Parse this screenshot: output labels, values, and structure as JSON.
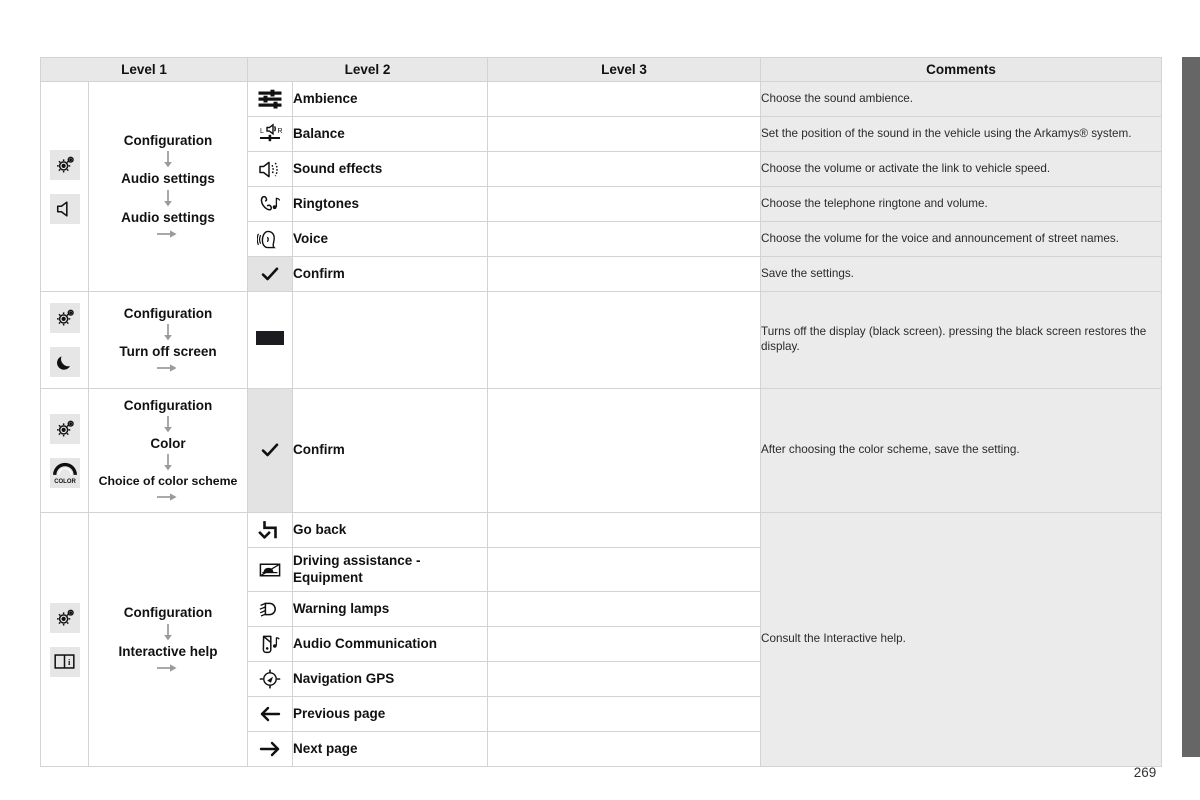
{
  "page": {
    "number": "269"
  },
  "table": {
    "headers": [
      "Level 1",
      "Level 2",
      "Level 3",
      "Comments"
    ],
    "blocks": [
      {
        "id": "audio-settings",
        "level1": {
          "icons": [
            "gear-icon",
            "speaker-icon"
          ],
          "steps": [
            "Configuration",
            "Audio settings",
            "Audio settings"
          ],
          "trailing_arrow": true
        },
        "rows": [
          {
            "icon": "equalizer-icon",
            "icon_shaded": false,
            "label": "Ambience",
            "level3": "",
            "comment": "Choose the sound ambience."
          },
          {
            "icon": "balance-icon",
            "icon_shaded": false,
            "label": "Balance",
            "level3": "",
            "comment": "Set the position of the sound in the vehicle using the Arkamys® system."
          },
          {
            "icon": "sound-effects-icon",
            "icon_shaded": false,
            "label": "Sound effects",
            "level3": "",
            "comment": "Choose the volume or activate the link to vehicle speed."
          },
          {
            "icon": "ringtone-icon",
            "icon_shaded": false,
            "label": "Ringtones",
            "level3": "",
            "comment": "Choose the telephone ringtone and volume."
          },
          {
            "icon": "voice-icon",
            "icon_shaded": false,
            "label": "Voice",
            "level3": "",
            "comment": "Choose the volume for the voice and announcement of street names."
          },
          {
            "icon": "check-icon",
            "icon_shaded": true,
            "label": "Confirm",
            "level3": "",
            "comment": "Save the settings."
          }
        ]
      },
      {
        "id": "turn-off-screen",
        "level1": {
          "icons": [
            "gear-icon",
            "moon-icon"
          ],
          "steps": [
            "Configuration",
            "Turn off screen"
          ],
          "trailing_arrow": true
        },
        "rows": [
          {
            "icon": "black-screen-icon",
            "icon_shaded": false,
            "label": "",
            "level3": "",
            "comment": "Turns off the display (black screen). pressing the black screen restores the display."
          }
        ]
      },
      {
        "id": "color",
        "level1": {
          "icons": [
            "gear-icon",
            "color-icon"
          ],
          "steps": [
            "Configuration",
            "Color",
            "Choice of color scheme"
          ],
          "trailing_arrow": true
        },
        "rows": [
          {
            "icon": "check-icon",
            "icon_shaded": true,
            "label": "Confirm",
            "level3": "",
            "comment": "After choosing the color scheme, save the setting."
          }
        ]
      },
      {
        "id": "interactive-help",
        "level1": {
          "icons": [
            "gear-icon",
            "manual-book-icon"
          ],
          "steps": [
            "Configuration",
            "Interactive help"
          ],
          "trailing_arrow": true
        },
        "rows": [
          {
            "icon": "go-back-icon",
            "icon_shaded": false,
            "label": "Go back",
            "level3": "",
            "comment": "Consult the Interactive help."
          },
          {
            "icon": "driving-assist-icon",
            "icon_shaded": false,
            "label": "Driving assistance - Equipment",
            "level3": "",
            "comment": ""
          },
          {
            "icon": "warning-lamp-icon",
            "icon_shaded": false,
            "label": "Warning lamps",
            "level3": "",
            "comment": ""
          },
          {
            "icon": "audio-comm-icon",
            "icon_shaded": false,
            "label": "Audio Communication",
            "level3": "",
            "comment": ""
          },
          {
            "icon": "navigation-gps-icon",
            "icon_shaded": false,
            "label": "Navigation GPS",
            "level3": "",
            "comment": ""
          },
          {
            "icon": "arrow-left-icon",
            "icon_shaded": false,
            "label": "Previous page",
            "level3": "",
            "comment": ""
          },
          {
            "icon": "arrow-right-icon",
            "icon_shaded": false,
            "label": "Next page",
            "level3": "",
            "comment": ""
          }
        ]
      }
    ]
  },
  "colors": {
    "header_bg": "#e8e8e8",
    "comments_bg": "#ebebeb",
    "chip_bg": "#e6e6e6",
    "border": "#d3d3d3",
    "edge_strip": "#666666"
  }
}
